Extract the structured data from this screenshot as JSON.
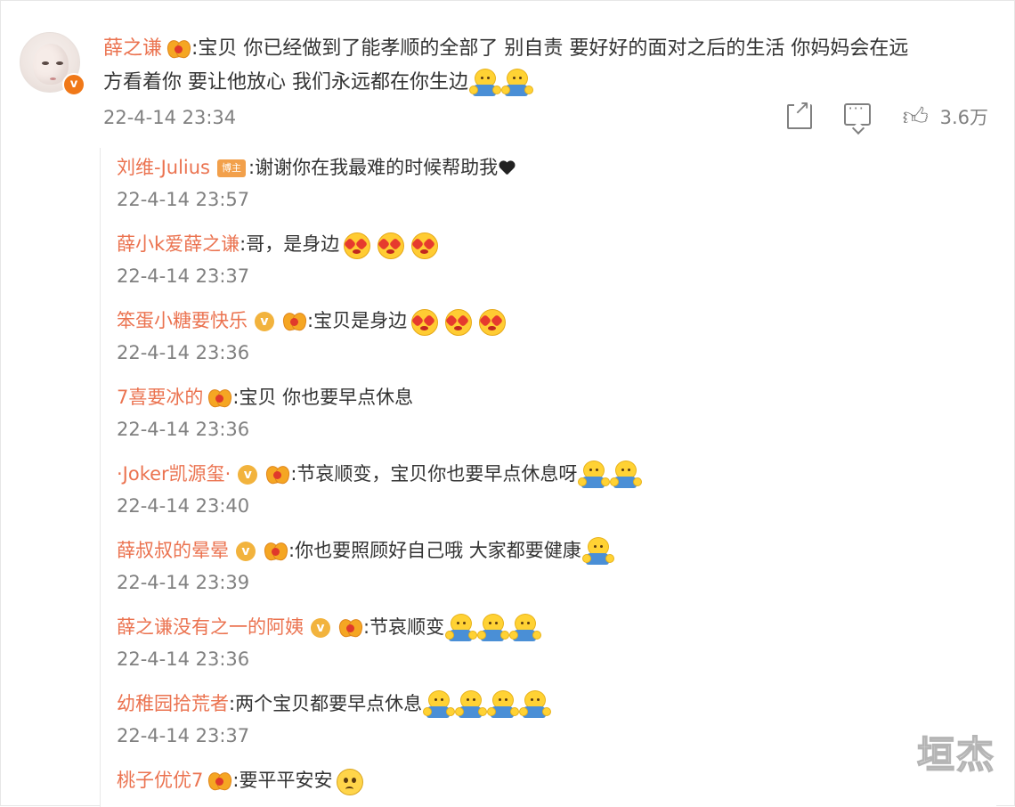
{
  "main_comment": {
    "username": "薛之谦",
    "text_line1": ":宝贝 你已经做到了能孝顺的全部了 别自责 要好好的面对之后的生活 你妈妈会在远",
    "text_line2": "方看着你 要让他放心 我们永远都在你生边",
    "timestamp": "22-4-14 23:34",
    "like_count": "3.6万",
    "verified_badge": "v",
    "icons": [
      "share-icon",
      "comment-icon",
      "like-icon"
    ]
  },
  "host_badge_label": "博主",
  "replies": [
    {
      "user": "刘维-Julius",
      "text": ":谢谢你在我最难的时候帮助我",
      "time": "22-4-14 23:57"
    },
    {
      "user": "薛小k爱薛之谦",
      "text": ":哥，是身边",
      "time": "22-4-14 23:37"
    },
    {
      "user": "笨蛋小糖要快乐",
      "text": ":宝贝是身边",
      "time": "22-4-14 23:36"
    },
    {
      "user": "7喜要冰的",
      "text": ":宝贝 你也要早点休息",
      "time": "22-4-14 23:36"
    },
    {
      "user": "·Joker凯源玺·",
      "text": ":节哀顺变，宝贝你也要早点休息呀",
      "time": "22-4-14 23:40"
    },
    {
      "user": "薛叔叔的晕晕",
      "text": ":你也要照顾好自己哦 大家都要健康",
      "time": "22-4-14 23:39"
    },
    {
      "user": "薛之谦没有之一的阿姨",
      "text": ":节哀顺变",
      "time": "22-4-14 23:36"
    },
    {
      "user": "幼稚园拾荒者",
      "text": ":两个宝贝都要早点休息",
      "time": "22-4-14 23:37"
    },
    {
      "user": "桃子优优7",
      "text": ":要平平安安",
      "time": ""
    }
  ],
  "watermark": "垣杰",
  "colors": {
    "username": "#eb7350",
    "meta": "#808080",
    "badge": "#f2b33d",
    "host_badge": "#f2a04b"
  }
}
